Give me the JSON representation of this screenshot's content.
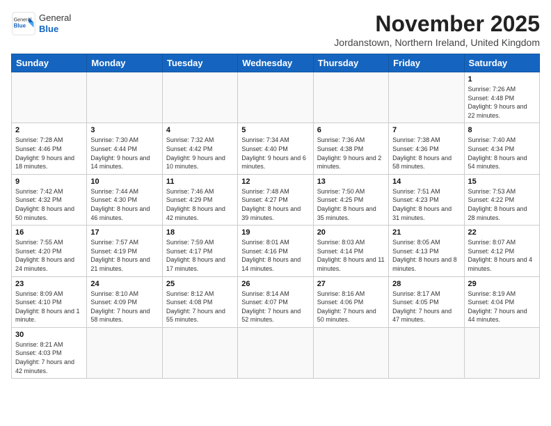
{
  "header": {
    "logo_general": "General",
    "logo_blue": "Blue",
    "month": "November 2025",
    "location": "Jordanstown, Northern Ireland, United Kingdom"
  },
  "days_of_week": [
    "Sunday",
    "Monday",
    "Tuesday",
    "Wednesday",
    "Thursday",
    "Friday",
    "Saturday"
  ],
  "weeks": [
    [
      {
        "day": "",
        "info": ""
      },
      {
        "day": "",
        "info": ""
      },
      {
        "day": "",
        "info": ""
      },
      {
        "day": "",
        "info": ""
      },
      {
        "day": "",
        "info": ""
      },
      {
        "day": "",
        "info": ""
      },
      {
        "day": "1",
        "info": "Sunrise: 7:26 AM\nSunset: 4:48 PM\nDaylight: 9 hours\nand 22 minutes."
      }
    ],
    [
      {
        "day": "2",
        "info": "Sunrise: 7:28 AM\nSunset: 4:46 PM\nDaylight: 9 hours\nand 18 minutes."
      },
      {
        "day": "3",
        "info": "Sunrise: 7:30 AM\nSunset: 4:44 PM\nDaylight: 9 hours\nand 14 minutes."
      },
      {
        "day": "4",
        "info": "Sunrise: 7:32 AM\nSunset: 4:42 PM\nDaylight: 9 hours\nand 10 minutes."
      },
      {
        "day": "5",
        "info": "Sunrise: 7:34 AM\nSunset: 4:40 PM\nDaylight: 9 hours\nand 6 minutes."
      },
      {
        "day": "6",
        "info": "Sunrise: 7:36 AM\nSunset: 4:38 PM\nDaylight: 9 hours\nand 2 minutes."
      },
      {
        "day": "7",
        "info": "Sunrise: 7:38 AM\nSunset: 4:36 PM\nDaylight: 8 hours\nand 58 minutes."
      },
      {
        "day": "8",
        "info": "Sunrise: 7:40 AM\nSunset: 4:34 PM\nDaylight: 8 hours\nand 54 minutes."
      }
    ],
    [
      {
        "day": "9",
        "info": "Sunrise: 7:42 AM\nSunset: 4:32 PM\nDaylight: 8 hours\nand 50 minutes."
      },
      {
        "day": "10",
        "info": "Sunrise: 7:44 AM\nSunset: 4:30 PM\nDaylight: 8 hours\nand 46 minutes."
      },
      {
        "day": "11",
        "info": "Sunrise: 7:46 AM\nSunset: 4:29 PM\nDaylight: 8 hours\nand 42 minutes."
      },
      {
        "day": "12",
        "info": "Sunrise: 7:48 AM\nSunset: 4:27 PM\nDaylight: 8 hours\nand 39 minutes."
      },
      {
        "day": "13",
        "info": "Sunrise: 7:50 AM\nSunset: 4:25 PM\nDaylight: 8 hours\nand 35 minutes."
      },
      {
        "day": "14",
        "info": "Sunrise: 7:51 AM\nSunset: 4:23 PM\nDaylight: 8 hours\nand 31 minutes."
      },
      {
        "day": "15",
        "info": "Sunrise: 7:53 AM\nSunset: 4:22 PM\nDaylight: 8 hours\nand 28 minutes."
      }
    ],
    [
      {
        "day": "16",
        "info": "Sunrise: 7:55 AM\nSunset: 4:20 PM\nDaylight: 8 hours\nand 24 minutes."
      },
      {
        "day": "17",
        "info": "Sunrise: 7:57 AM\nSunset: 4:19 PM\nDaylight: 8 hours\nand 21 minutes."
      },
      {
        "day": "18",
        "info": "Sunrise: 7:59 AM\nSunset: 4:17 PM\nDaylight: 8 hours\nand 17 minutes."
      },
      {
        "day": "19",
        "info": "Sunrise: 8:01 AM\nSunset: 4:16 PM\nDaylight: 8 hours\nand 14 minutes."
      },
      {
        "day": "20",
        "info": "Sunrise: 8:03 AM\nSunset: 4:14 PM\nDaylight: 8 hours\nand 11 minutes."
      },
      {
        "day": "21",
        "info": "Sunrise: 8:05 AM\nSunset: 4:13 PM\nDaylight: 8 hours\nand 8 minutes."
      },
      {
        "day": "22",
        "info": "Sunrise: 8:07 AM\nSunset: 4:12 PM\nDaylight: 8 hours\nand 4 minutes."
      }
    ],
    [
      {
        "day": "23",
        "info": "Sunrise: 8:09 AM\nSunset: 4:10 PM\nDaylight: 8 hours\nand 1 minute."
      },
      {
        "day": "24",
        "info": "Sunrise: 8:10 AM\nSunset: 4:09 PM\nDaylight: 7 hours\nand 58 minutes."
      },
      {
        "day": "25",
        "info": "Sunrise: 8:12 AM\nSunset: 4:08 PM\nDaylight: 7 hours\nand 55 minutes."
      },
      {
        "day": "26",
        "info": "Sunrise: 8:14 AM\nSunset: 4:07 PM\nDaylight: 7 hours\nand 52 minutes."
      },
      {
        "day": "27",
        "info": "Sunrise: 8:16 AM\nSunset: 4:06 PM\nDaylight: 7 hours\nand 50 minutes."
      },
      {
        "day": "28",
        "info": "Sunrise: 8:17 AM\nSunset: 4:05 PM\nDaylight: 7 hours\nand 47 minutes."
      },
      {
        "day": "29",
        "info": "Sunrise: 8:19 AM\nSunset: 4:04 PM\nDaylight: 7 hours\nand 44 minutes."
      }
    ],
    [
      {
        "day": "30",
        "info": "Sunrise: 8:21 AM\nSunset: 4:03 PM\nDaylight: 7 hours\nand 42 minutes."
      },
      {
        "day": "",
        "info": ""
      },
      {
        "day": "",
        "info": ""
      },
      {
        "day": "",
        "info": ""
      },
      {
        "day": "",
        "info": ""
      },
      {
        "day": "",
        "info": ""
      },
      {
        "day": "",
        "info": ""
      }
    ]
  ]
}
